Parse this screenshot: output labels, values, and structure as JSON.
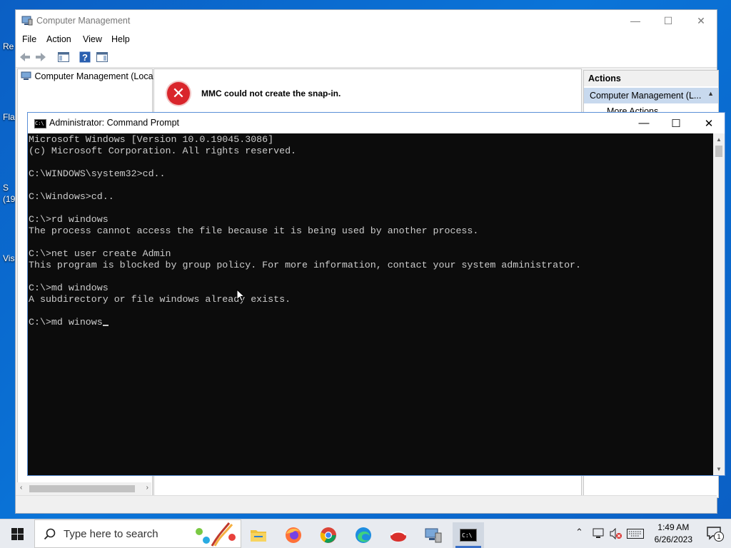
{
  "desktop": {
    "labels": [
      "Re",
      "Fla",
      "S",
      "(19",
      "Vis"
    ]
  },
  "computer_management": {
    "title": "Computer Management",
    "menu": [
      "File",
      "Action",
      "View",
      "Help"
    ],
    "tree_item": "Computer Management (Local",
    "error_message": "MMC could not create the snap-in.",
    "actions_header": "Actions",
    "actions_selected": "Computer Management (L...",
    "actions_more": "More Actions"
  },
  "cmd": {
    "title": "Administrator: Command Prompt",
    "lines": [
      "Microsoft Windows [Version 10.0.19045.3086]",
      "(c) Microsoft Corporation. All rights reserved.",
      "",
      "C:\\WINDOWS\\system32>cd..",
      "",
      "C:\\Windows>cd..",
      "",
      "C:\\>rd windows",
      "The process cannot access the file because it is being used by another process.",
      "",
      "C:\\>net user create Admin",
      "This program is blocked by group policy. For more information, contact your system administrator.",
      "",
      "C:\\>md windows",
      "A subdirectory or file windows already exists.",
      ""
    ],
    "current_input": "C:\\>md winows"
  },
  "taskbar": {
    "search_placeholder": "Type here to search",
    "apps": [
      "file-explorer",
      "firefox",
      "chrome",
      "edge",
      "app-red",
      "computer-management",
      "command-prompt"
    ],
    "time": "1:49 AM",
    "date": "6/26/2023",
    "notification_count": "1"
  }
}
